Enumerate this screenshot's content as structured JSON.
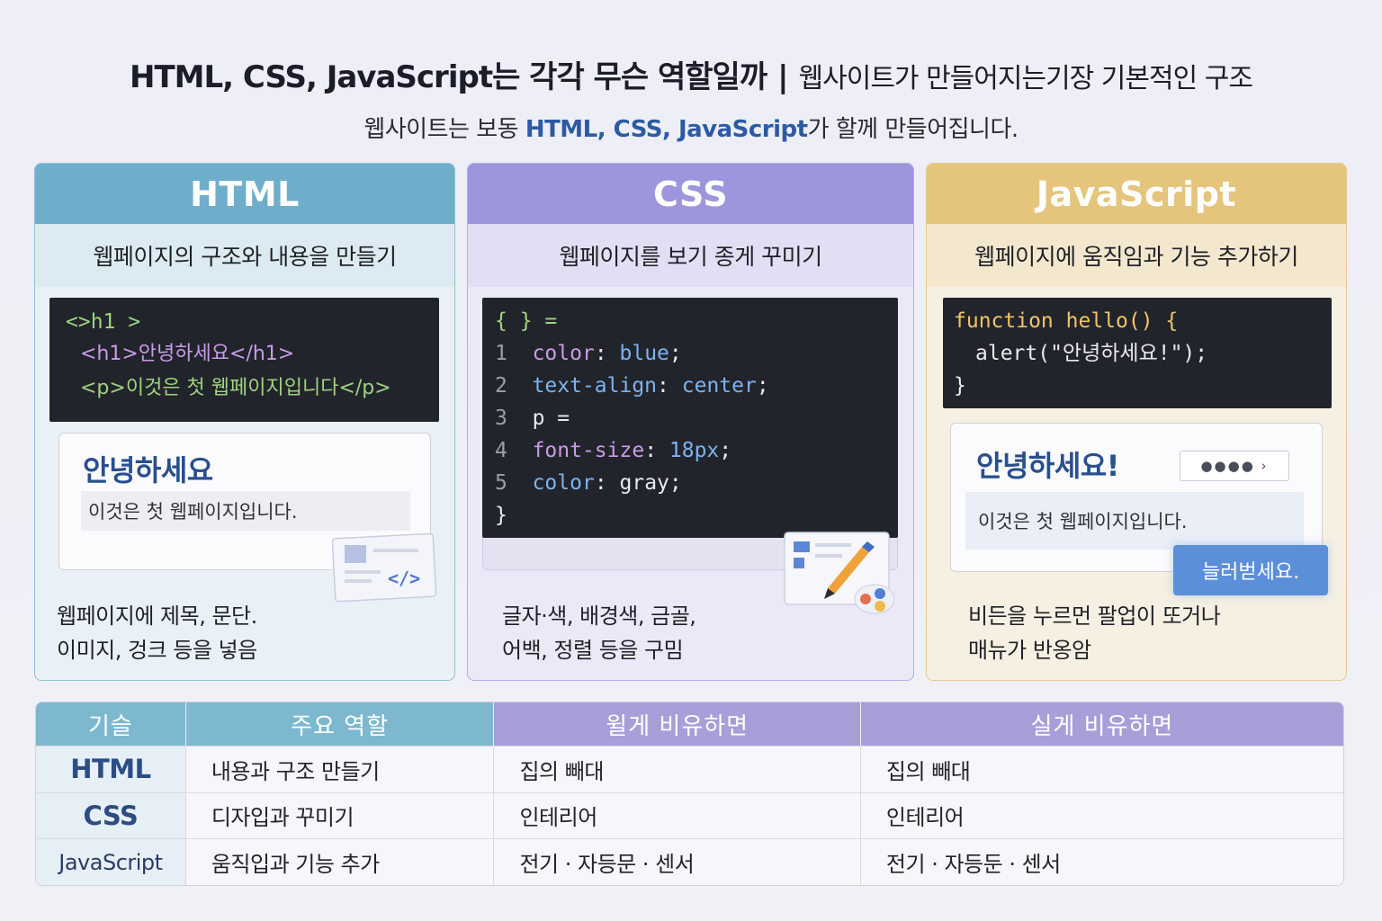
{
  "header": {
    "title_main": "HTML, CSS, JavaScript는 각각 무슨 역할일까",
    "title_sep": "|",
    "title_sub": "웹사이트가 만들어지는기장 기본적인 구조",
    "subtitle_pre": "웹사이트는 보동 ",
    "subtitle_hl": "HTML, CSS, JavaScript",
    "subtitle_post": "가 할께 만들어집니다."
  },
  "cards": {
    "html": {
      "title": "HTML",
      "desc": "웹페이지의 구조와 내용을 만들기",
      "code": [
        "<>h1 >",
        "<h1>안녕하세요</h1>",
        "<p>이것은 첫 웹페이지입니다</p>"
      ],
      "preview_heading": "안녕하세요",
      "preview_text": "이것은 첫 웹페이지입니다.",
      "footer": [
        "웹페이지에 제목, 문단.",
        "이미지, 겅크 등을 넣음"
      ]
    },
    "css": {
      "title": "CSS",
      "desc": "웹페이지를 보기 종게 꾸미기",
      "code_header": "{ } =",
      "lines": [
        {
          "n": "1",
          "prop": "color",
          "val": "blue"
        },
        {
          "n": "2",
          "prop": "text-align",
          "val": "center"
        },
        {
          "n": "3",
          "prop": "p =",
          "val": ""
        },
        {
          "n": "4",
          "prop": "font-size",
          "val": "18px"
        },
        {
          "n": "5",
          "prop": "color",
          "val": "gray"
        }
      ],
      "code_footer": "}",
      "footer": [
        "글자·색, 배경색, 금골,",
        "어백, 정렬 등을 구밈"
      ]
    },
    "js": {
      "title": "JavaScript",
      "desc": "웹페이지에 움직임과 기능  추가하기",
      "code": [
        "function hello() {",
        "alert(\"안녕하세요!\");",
        "}"
      ],
      "preview_heading": "안녕하세요!",
      "preview_text": "이것은 첫 웹페이지입니다.",
      "button_label": "늘러벋세요.",
      "dots": "●●●● ›",
      "footer": [
        "비든을 누르먼 팔업이 또거나",
        "매뉴가 반옹암"
      ]
    }
  },
  "table": {
    "headers": [
      "기슬",
      "주요 역할",
      "윌게 비유하면",
      "실게 비유하면"
    ],
    "rows": [
      {
        "tech": "HTML",
        "role": "내용과 구조 만들기",
        "a": "집의 빼대",
        "b": "집의 빼대"
      },
      {
        "tech": "CSS",
        "role": "디자입과 꾸미기",
        "a": "인테리어",
        "b": "인테리어"
      },
      {
        "tech": "JavaScript",
        "role": "움직입과 기능 추가",
        "a": "전기 · 자등문 · 센서",
        "b": "전기 · 자등둔 · 센서"
      }
    ]
  },
  "colors": {
    "html_accent": "#6eaecb",
    "css_accent": "#9e96dc",
    "js_accent": "#e5c57c",
    "highlight_text": "#2b5ba5"
  }
}
